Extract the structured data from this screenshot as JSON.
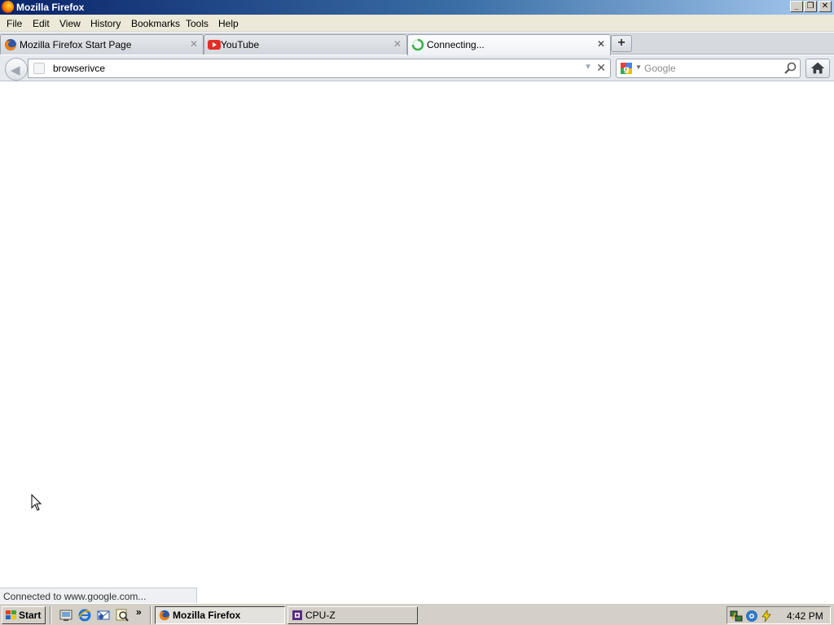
{
  "window": {
    "title": "Mozilla Firefox"
  },
  "menu": [
    {
      "label": "File"
    },
    {
      "label": "Edit"
    },
    {
      "label": "View"
    },
    {
      "label": "History"
    },
    {
      "label": "Bookmarks"
    },
    {
      "label": "Tools"
    },
    {
      "label": "Help"
    }
  ],
  "tabs": [
    {
      "label": "Mozilla Firefox Start Page",
      "icon": "firefox-icon",
      "active": false
    },
    {
      "label": "YouTube",
      "icon": "youtube-icon",
      "active": false
    },
    {
      "label": "Connecting...",
      "icon": "loading-spinner-icon",
      "active": true
    }
  ],
  "navbar": {
    "url_value": "browserivce",
    "search_placeholder": "Google"
  },
  "status_text": "Connected to www.google.com...",
  "taskbar": {
    "start_label": "Start",
    "quick_launch_icons": [
      "show-desktop-icon",
      "internet-explorer-icon",
      "outlook-icon",
      "search-icon"
    ],
    "more_label": "»",
    "tasks": [
      {
        "label": "Mozilla Firefox",
        "icon": "firefox-icon",
        "pressed": true
      },
      {
        "label": "CPU-Z",
        "icon": "cpuz-icon",
        "pressed": false
      }
    ],
    "tray_icons": [
      "network-icon",
      "security-icon",
      "power-icon"
    ],
    "clock": "4:42 PM"
  },
  "colors": {
    "titlebar_start": "#0a246a",
    "titlebar_end": "#a6caf0",
    "tabstrip": "#d6d9de",
    "taskbar": "#d4d0c8"
  }
}
